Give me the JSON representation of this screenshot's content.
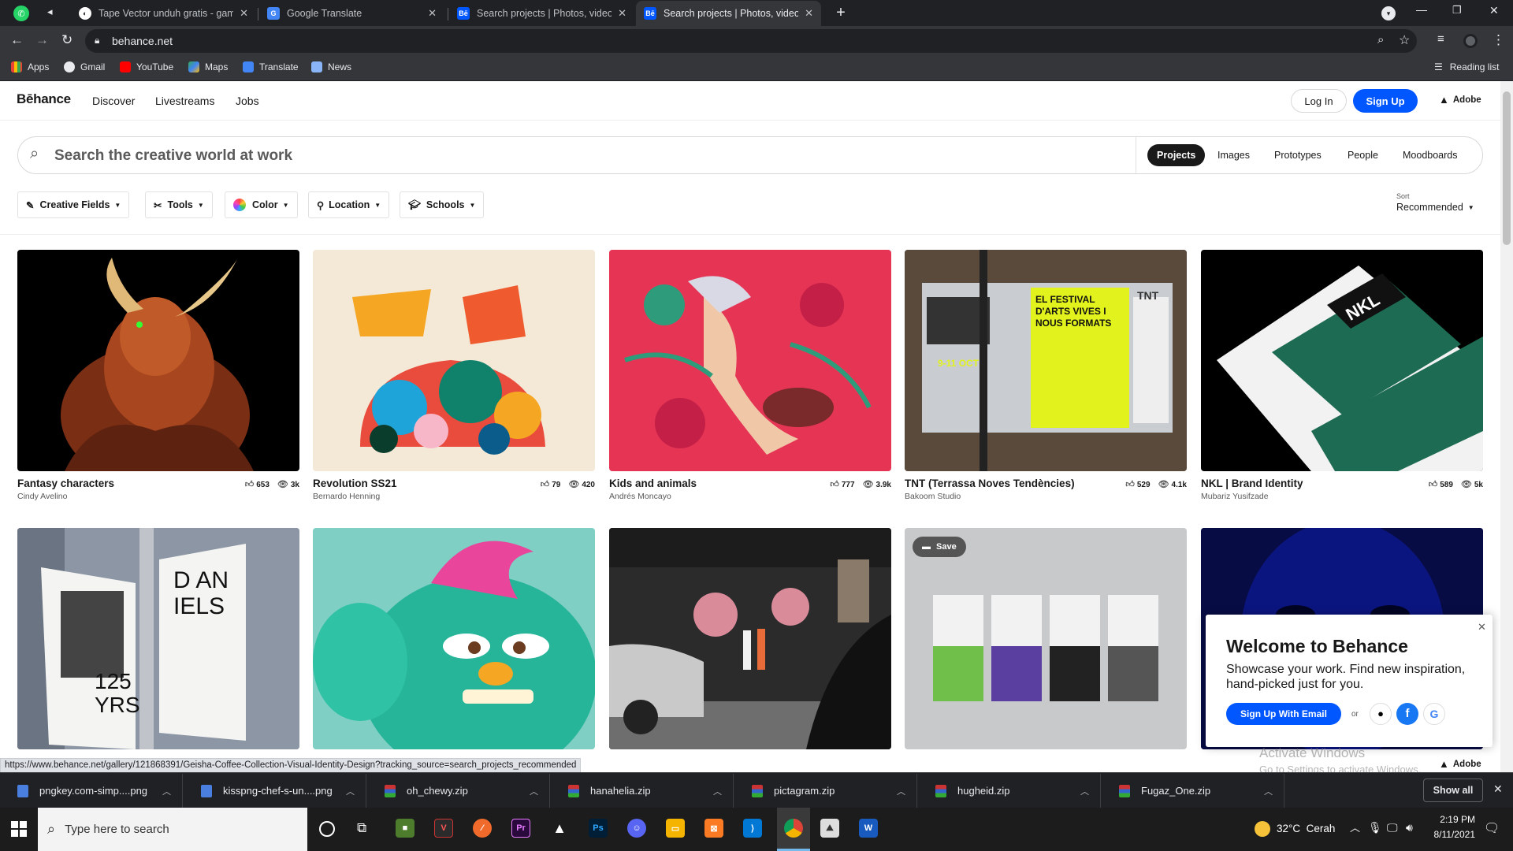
{
  "browser": {
    "tabs": [
      {
        "title": "Tape Vector unduh gratis - gamb",
        "active": false
      },
      {
        "title": "Google Translate",
        "active": false
      },
      {
        "title": "Search projects | Photos, videos,",
        "active": false
      },
      {
        "title": "Search projects | Photos, videos,",
        "active": true
      }
    ],
    "url": "behance.net",
    "bookmarks": [
      "Apps",
      "Gmail",
      "YouTube",
      "Maps",
      "Translate",
      "News"
    ],
    "reading_list": "Reading list",
    "status_url": "https://www.behance.net/gallery/121868391/Geisha-Coffee-Collection-Visual-Identity-Design?tracking_source=search_projects_recommended"
  },
  "behance": {
    "logo": "Bēhance",
    "nav": [
      "Discover",
      "Livestreams",
      "Jobs"
    ],
    "login": "Log In",
    "signup": "Sign Up",
    "adobe": "Adobe",
    "search_placeholder": "Search the creative world at work",
    "search_tabs": [
      "Projects",
      "Images",
      "Prototypes",
      "People",
      "Moodboards"
    ],
    "filters": [
      "Creative Fields",
      "Tools",
      "Color",
      "Location",
      "Schools"
    ],
    "sort_label": "Sort",
    "sort_value": "Recommended",
    "projects": [
      {
        "title": "Fantasy characters",
        "owner": "Cindy Avelino",
        "likes": "653",
        "views": "3k"
      },
      {
        "title": "Revolution SS21",
        "owner": "Bernardo Henning",
        "likes": "79",
        "views": "420"
      },
      {
        "title": "Kids and animals",
        "owner": "Andrés Moncayo",
        "likes": "777",
        "views": "3.9k"
      },
      {
        "title": "TNT (Terrassa Noves Tendències)",
        "owner": "Bakoom Studio",
        "likes": "529",
        "views": "4.1k"
      },
      {
        "title": "NKL | Brand Identity",
        "owner": "Mubariz Yusifzade",
        "likes": "589",
        "views": "5k"
      }
    ],
    "card_texts": {
      "daniels": "D AN IELS",
      "years": "125 YRS",
      "save": "Save",
      "tnt": "TNT",
      "festival": "EL FESTIVAL D'ARTS VIVES I NOUS FORMATS",
      "dates": "9-11 OCT",
      "nkl": "NKL"
    },
    "welcome": {
      "title": "Welcome to Behance",
      "body": "Showcase your work. Find new inspiration, hand-picked just for you.",
      "button": "Sign Up With Email",
      "or": "or"
    },
    "activate": {
      "line1": "Activate Windows",
      "line2": "Go to Settings to activate Windows."
    }
  },
  "downloads": {
    "items": [
      "pngkey.com-simp....png",
      "kisspng-chef-s-un....png",
      "oh_chewy.zip",
      "hanahelia.zip",
      "pictagram.zip",
      "hugheid.zip",
      "Fugaz_One.zip"
    ],
    "show_all": "Show all"
  },
  "taskbar": {
    "search_placeholder": "Type here to search",
    "weather": "32°C  Cerah",
    "time": "2:19 PM",
    "date": "8/11/2021"
  },
  "colors": {
    "behance_blue": "#0057ff",
    "chrome_dark": "#202124",
    "chrome_toolbar": "#35363a"
  }
}
